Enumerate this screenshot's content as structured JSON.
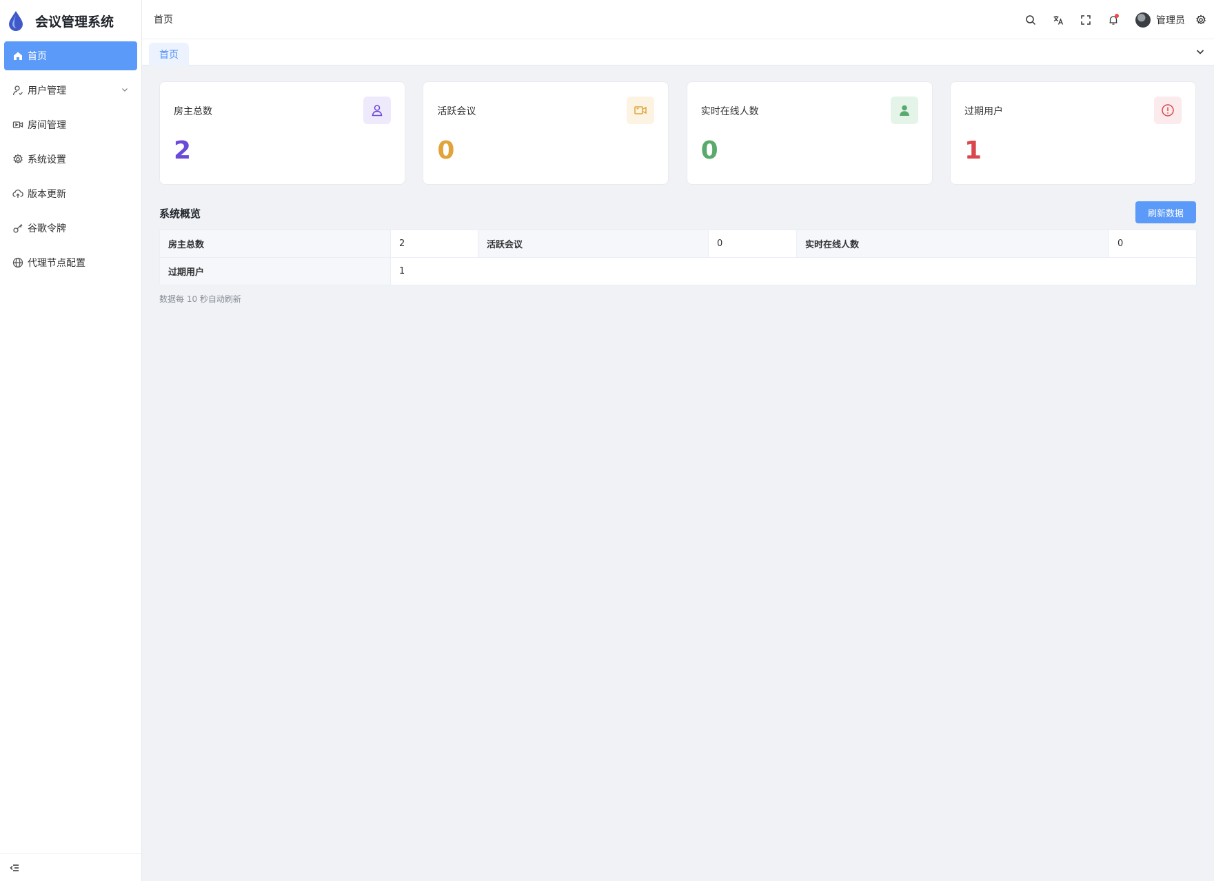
{
  "app": {
    "title": "会议管理系统"
  },
  "sidebar": {
    "items": [
      {
        "label": "首页",
        "icon": "home-icon",
        "active": true
      },
      {
        "label": "用户管理",
        "icon": "user-manage-icon",
        "has_children": true
      },
      {
        "label": "房间管理",
        "icon": "video-camera-icon"
      },
      {
        "label": "系统设置",
        "icon": "gear-icon"
      },
      {
        "label": "版本更新",
        "icon": "cloud-upload-icon"
      },
      {
        "label": "谷歌令牌",
        "icon": "key-icon"
      },
      {
        "label": "代理节点配置",
        "icon": "globe-icon"
      }
    ]
  },
  "header": {
    "breadcrumb": "首页",
    "user_name": "管理员",
    "icons": [
      "search-icon",
      "translate-icon",
      "fullscreen-icon",
      "bell-icon",
      "gear-icon"
    ]
  },
  "tabs": [
    {
      "label": "首页",
      "active": true
    }
  ],
  "stats": [
    {
      "label": "房主总数",
      "value": "2",
      "color": "#6a4ad8",
      "bg": "#efeafb",
      "icon": "user-outline-icon"
    },
    {
      "label": "活跃会议",
      "value": "0",
      "color": "#e0a43a",
      "bg": "#fdf3e2",
      "icon": "video-camera-icon"
    },
    {
      "label": "实时在线人数",
      "value": "0",
      "color": "#5aaa6e",
      "bg": "#e5f4e9",
      "icon": "user-filled-icon"
    },
    {
      "label": "过期用户",
      "value": "1",
      "color": "#d9474c",
      "bg": "#fcebec",
      "icon": "warning-circle-icon"
    }
  ],
  "overview": {
    "title": "系统概览",
    "refresh_label": "刷新数据",
    "rows": [
      [
        {
          "k": "房主总数",
          "v": "2"
        },
        {
          "k": "活跃会议",
          "v": "0"
        },
        {
          "k": "实时在线人数",
          "v": "0"
        }
      ],
      [
        {
          "k": "过期用户",
          "v": "1"
        }
      ]
    ],
    "note": "数据每 10 秒自动刷新"
  },
  "colors": {
    "accent": "#5b9af8",
    "page_bg": "#f0f2f5"
  }
}
